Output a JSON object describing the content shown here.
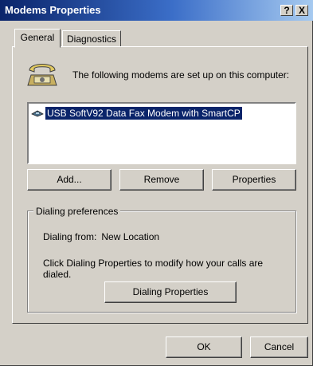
{
  "window": {
    "title": "Modems Properties",
    "help_label": "?",
    "close_label": "X"
  },
  "tabs": [
    {
      "label": "General"
    },
    {
      "label": "Diagnostics"
    }
  ],
  "general": {
    "intro": "The following modems are set up on this computer:",
    "modems": [
      {
        "name": "USB SoftV92 Data Fax Modem with SmartCP",
        "icon": "modem-icon",
        "selected": true
      }
    ],
    "buttons": {
      "add": "Add...",
      "remove": "Remove",
      "properties": "Properties"
    },
    "dialing": {
      "group_label": "Dialing preferences",
      "from_label": "Dialing from:",
      "from_value": "New Location",
      "description": "Click Dialing Properties to modify how your calls are dialed.",
      "button": "Dialing Properties"
    }
  },
  "footer": {
    "ok": "OK",
    "cancel": "Cancel"
  },
  "colors": {
    "titlebar": "#0a246a",
    "face": "#d4d0c8",
    "selection": "#0a246a"
  }
}
